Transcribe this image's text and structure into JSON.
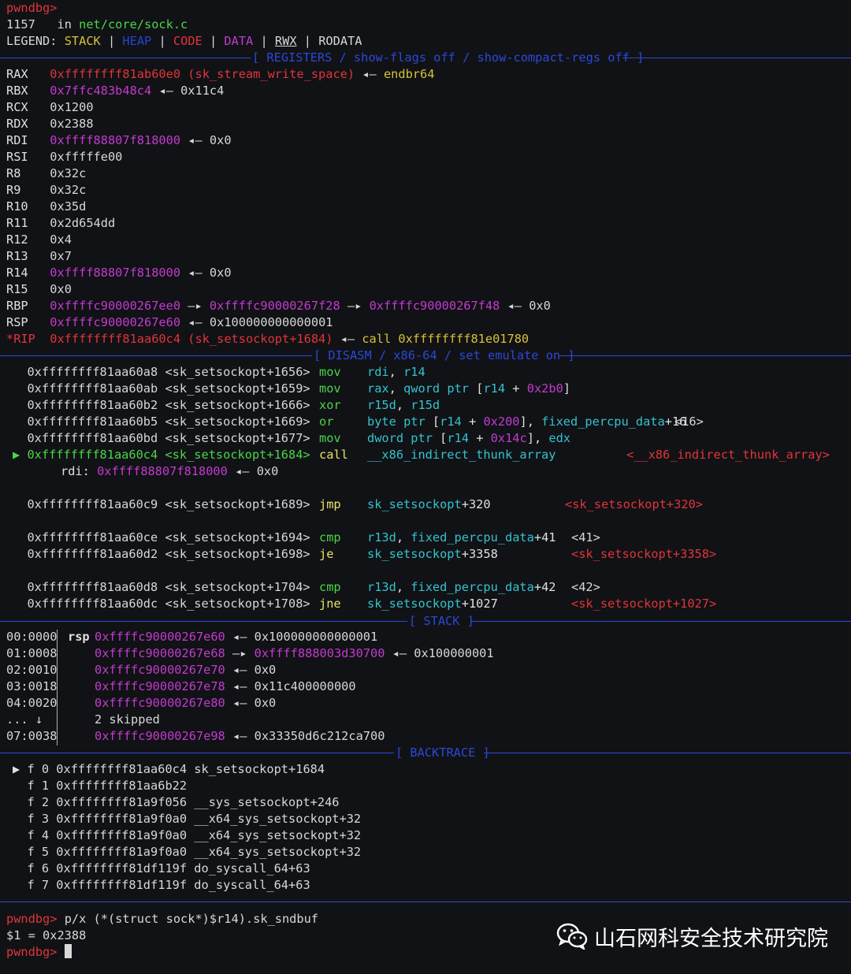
{
  "prompt": "pwndbg>",
  "top": {
    "line_no": "1157",
    "in_word": "in",
    "file": "net/core/sock.c",
    "legend_label": "LEGEND:",
    "legend": [
      "STACK",
      "HEAP",
      "CODE",
      "DATA",
      "RWX",
      "RODATA"
    ],
    "sep": "|"
  },
  "headers": {
    "registers": "[ REGISTERS / show-flags off / show-compact-regs off ]",
    "disasm": "[ DISASM / x86-64 / set emulate on ]",
    "stack": "[ STACK ]",
    "backtrace": "[ BACKTRACE ]"
  },
  "arrows": {
    "left": "◂—",
    "right": "—▸",
    "play": "▶"
  },
  "registers": [
    {
      "name": "RAX",
      "value": "0xffffffff81ab60e0",
      "value_color": "red",
      "sym": "(sk_stream_write_space)",
      "deref": "endbr64",
      "deref_color": "y"
    },
    {
      "name": "RBX",
      "value": "0x7ffc483b48c4",
      "value_color": "m",
      "deref": "0x11c4"
    },
    {
      "name": "RCX",
      "value": "0x1200"
    },
    {
      "name": "RDX",
      "value": "0x2388"
    },
    {
      "name": "RDI",
      "value": "0xffff88807f818000",
      "value_color": "m",
      "deref": "0x0"
    },
    {
      "name": "RSI",
      "value": "0xfffffe00"
    },
    {
      "name": "R8",
      "value": "0x32c"
    },
    {
      "name": "R9",
      "value": "0x32c"
    },
    {
      "name": "R10",
      "value": "0x35d"
    },
    {
      "name": "R11",
      "value": "0x2d654dd"
    },
    {
      "name": "R12",
      "value": "0x4"
    },
    {
      "name": "R13",
      "value": "0x7"
    },
    {
      "name": "R14",
      "value": "0xffff88807f818000",
      "value_color": "m",
      "deref": "0x0"
    },
    {
      "name": "R15",
      "value": "0x0"
    },
    {
      "name": "RBP",
      "value": "0xffffc90000267ee0",
      "value_color": "m",
      "chain": [
        "0xffffc90000267f28",
        "0xffffc90000267f48"
      ],
      "deref": "0x0"
    },
    {
      "name": "RSP",
      "value": "0xffffc90000267e60",
      "value_color": "m",
      "deref": "0x100000000000001"
    },
    {
      "name": "*RIP",
      "value": "0xffffffff81aa60c4",
      "value_color": "red",
      "sym": "(sk_setsockopt+1684)",
      "deref": "call 0xffffffff81e01780",
      "deref_color": "y"
    }
  ],
  "disasm": [
    {
      "addr": "0xffffffff81aa60a8",
      "sym": "<sk_setsockopt+1656>",
      "mn": "mov",
      "ops": "rdi, r14"
    },
    {
      "addr": "0xffffffff81aa60ab",
      "sym": "<sk_setsockopt+1659>",
      "mn": "mov",
      "ops": "rax, qword ptr [r14 + 0x2b0]"
    },
    {
      "addr": "0xffffffff81aa60b2",
      "sym": "<sk_setsockopt+1666>",
      "mn": "xor",
      "ops": "r15d, r15d"
    },
    {
      "addr": "0xffffffff81aa60b5",
      "sym": "<sk_setsockopt+1669>",
      "mn": "or",
      "ops": "byte ptr [r14 + 0x200], fixed_percpu_data+16",
      "target": "<16>"
    },
    {
      "addr": "0xffffffff81aa60bd",
      "sym": "<sk_setsockopt+1677>",
      "mn": "mov",
      "ops": "dword ptr [r14 + 0x14c], edx"
    },
    {
      "addr": "0xffffffff81aa60c4",
      "sym": "<sk_setsockopt+1684>",
      "mn": "call",
      "ops": "__x86_indirect_thunk_array",
      "target": "<__x86_indirect_thunk_array>",
      "current": true
    },
    {
      "arg_name": "rdi:",
      "arg_value": "0xffff88807f818000",
      "arg_deref": "0x0"
    },
    {
      "addr": "0xffffffff81aa60c9",
      "sym": "<sk_setsockopt+1689>",
      "mn": "jmp",
      "ops": "sk_setsockopt+320",
      "target": "<sk_setsockopt+320>"
    },
    {
      "addr": "0xffffffff81aa60ce",
      "sym": "<sk_setsockopt+1694>",
      "mn": "cmp",
      "ops": "r13d, fixed_percpu_data+41",
      "target": "<41>"
    },
    {
      "addr": "0xffffffff81aa60d2",
      "sym": "<sk_setsockopt+1698>",
      "mn": "je",
      "ops": "sk_setsockopt+3358",
      "target": "<sk_setsockopt+3358>"
    },
    {
      "addr": "0xffffffff81aa60d8",
      "sym": "<sk_setsockopt+1704>",
      "mn": "cmp",
      "ops": "r13d, fixed_percpu_data+42",
      "target": "<42>"
    },
    {
      "addr": "0xffffffff81aa60dc",
      "sym": "<sk_setsockopt+1708>",
      "mn": "jne",
      "ops": "sk_setsockopt+1027",
      "target": "<sk_setsockopt+1027>"
    }
  ],
  "stack": [
    {
      "idx": "00:0000",
      "reg": "rsp",
      "addr": "0xffffc90000267e60",
      "deref": "0x100000000000001"
    },
    {
      "idx": "01:0008",
      "addr": "0xffffc90000267e68",
      "chain": "0xffff888003d30700",
      "deref": "0x100000001"
    },
    {
      "idx": "02:0010",
      "addr": "0xffffc90000267e70",
      "deref": "0x0"
    },
    {
      "idx": "03:0018",
      "addr": "0xffffc90000267e78",
      "deref": "0x11c400000000"
    },
    {
      "idx": "04:0020",
      "addr": "0xffffc90000267e80",
      "deref": "0x0"
    },
    {
      "idx": "... ↓",
      "skipped": "2 skipped"
    },
    {
      "idx": "07:0038",
      "addr": "0xffffc90000267e98",
      "deref": "0x33350d6c212ca700"
    }
  ],
  "backtrace": [
    {
      "f": "f 0",
      "addr": "0xffffffff81aa60c4",
      "sym": "sk_setsockopt+1684",
      "current": true
    },
    {
      "f": "f 1",
      "addr": "0xffffffff81aa6b22",
      "sym": ""
    },
    {
      "f": "f 2",
      "addr": "0xffffffff81a9f056",
      "sym": "__sys_setsockopt+246"
    },
    {
      "f": "f 3",
      "addr": "0xffffffff81a9f0a0",
      "sym": "__x64_sys_setsockopt+32"
    },
    {
      "f": "f 4",
      "addr": "0xffffffff81a9f0a0",
      "sym": "__x64_sys_setsockopt+32"
    },
    {
      "f": "f 5",
      "addr": "0xffffffff81a9f0a0",
      "sym": "__x64_sys_setsockopt+32"
    },
    {
      "f": "f 6",
      "addr": "0xffffffff81df119f",
      "sym": "do_syscall_64+63"
    },
    {
      "f": "f 7",
      "addr": "0xffffffff81df119f",
      "sym": "do_syscall_64+63"
    }
  ],
  "command": {
    "input": "p/x (*(struct sock*)$r14).sk_sndbuf",
    "result": "$1 = 0x2388"
  },
  "watermark": "山石网科安全技术研究院",
  "colors": {
    "magenta": "#c33bd0",
    "red": "#e0353a",
    "yellow": "#d6c23a",
    "green": "#49d649",
    "blue": "#2b48d8",
    "cyan": "#33c3d0"
  }
}
